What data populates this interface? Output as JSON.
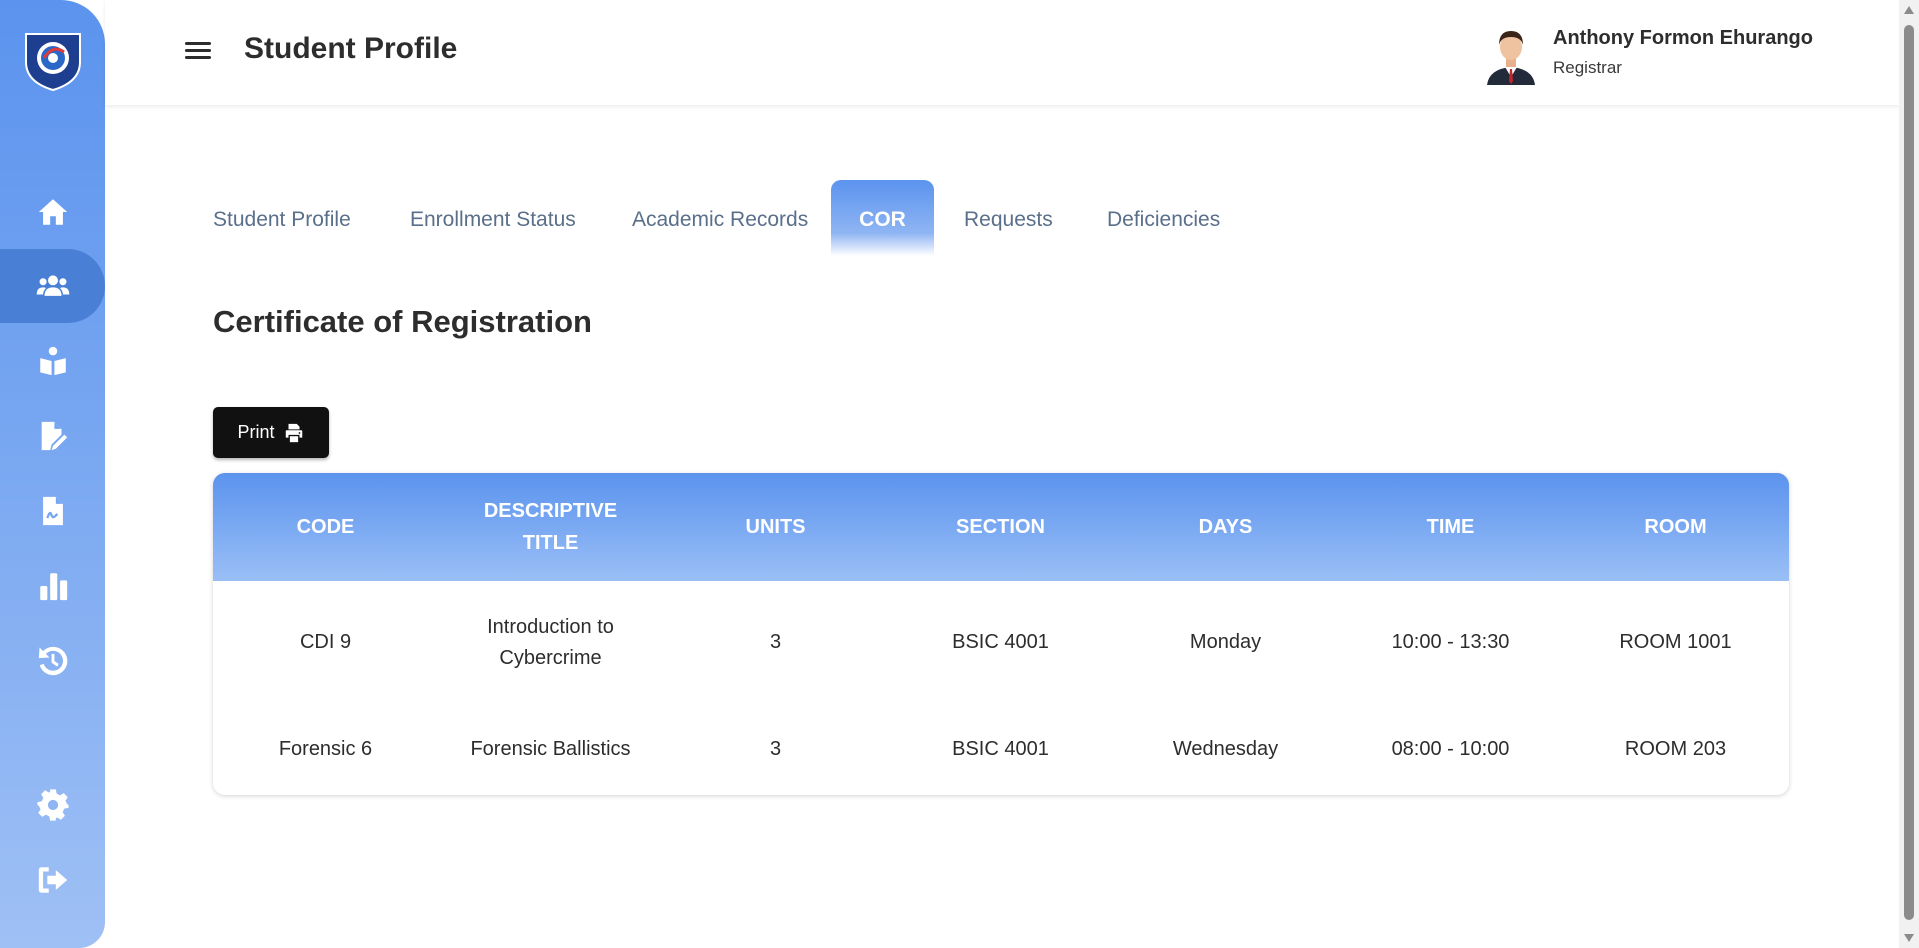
{
  "header": {
    "title": "Student Profile",
    "user_name": "Anthony Formon Ehurango",
    "user_role": "Registrar"
  },
  "sidebar": {
    "icons": [
      "home-icon",
      "users-icon",
      "reading-icon",
      "edit-document-icon",
      "signature-document-icon",
      "chart-icon",
      "history-icon",
      "settings-icon",
      "logout-icon"
    ],
    "active": "users-icon"
  },
  "tabs": [
    {
      "label": "Student Profile",
      "active": false
    },
    {
      "label": "Enrollment Status",
      "active": false
    },
    {
      "label": "Academic Records",
      "active": false
    },
    {
      "label": "COR",
      "active": true
    },
    {
      "label": "Requests",
      "active": false
    },
    {
      "label": "Deficiencies",
      "active": false
    }
  ],
  "section_title": "Certificate of Registration",
  "print_label": "Print",
  "table": {
    "columns": [
      "CODE",
      "DESCRIPTIVE TITLE",
      "UNITS",
      "SECTION",
      "DAYS",
      "TIME",
      "ROOM"
    ],
    "rows": [
      [
        "CDI 9",
        "Introduction to Cybercrime",
        "3",
        "BSIC 4001",
        "Monday",
        "10:00 - 13:30",
        "ROOM 1001"
      ],
      [
        "Forensic 6",
        "Forensic Ballistics",
        "3",
        "BSIC 4001",
        "Wednesday",
        "08:00 - 10:00",
        "ROOM 203"
      ]
    ]
  },
  "colors": {
    "accent": "#5b93ee",
    "sidebar_active": "#4a7fd6"
  }
}
